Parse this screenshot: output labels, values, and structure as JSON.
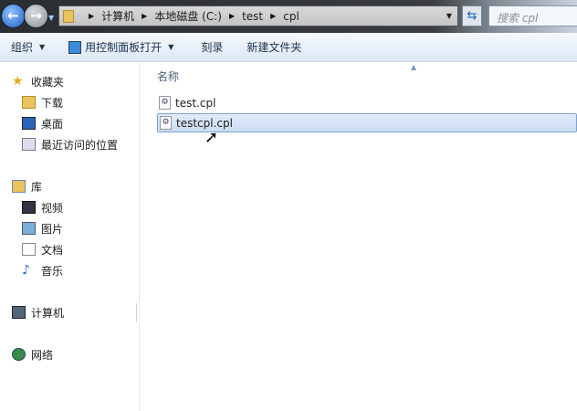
{
  "address": {
    "crumbs": [
      "计算机",
      "本地磁盘 (C:)",
      "test",
      "cpl"
    ]
  },
  "search": {
    "placeholder": "搜索 cpl"
  },
  "toolbar": {
    "organize": "组织",
    "open_cp": "用控制面板打开",
    "burn": "刻录",
    "new_folder": "新建文件夹"
  },
  "sidebar": {
    "favorites": "收藏夹",
    "downloads": "下载",
    "desktop": "桌面",
    "recent": "最近访问的位置",
    "libraries": "库",
    "videos": "视频",
    "pictures": "图片",
    "documents": "文档",
    "music": "音乐",
    "computer": "计算机",
    "network": "网络"
  },
  "main": {
    "column": "名称",
    "files": [
      "test.cpl",
      "testcpl.cpl"
    ]
  }
}
